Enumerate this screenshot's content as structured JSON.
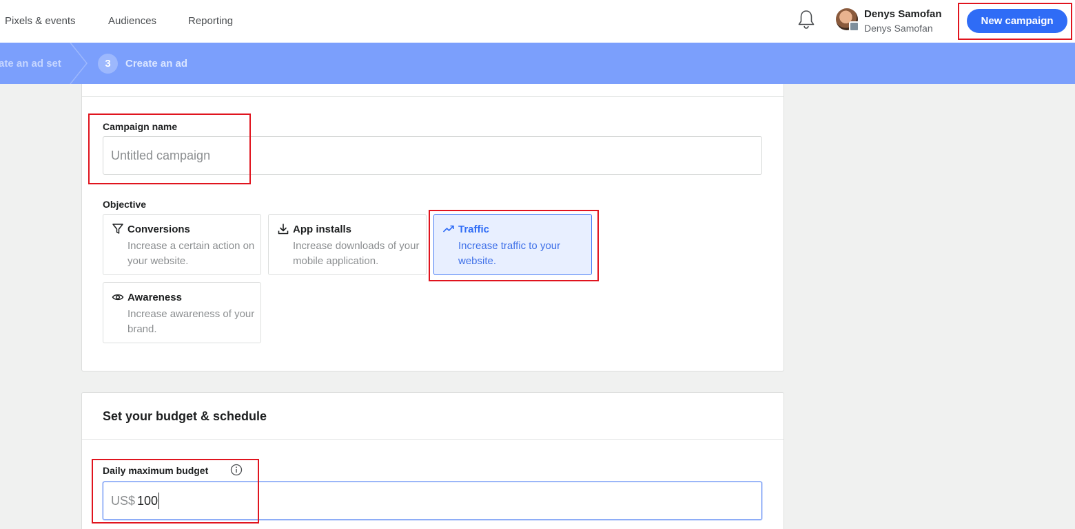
{
  "nav": {
    "items": [
      {
        "label": "Pixels & events"
      },
      {
        "label": "Audiences"
      },
      {
        "label": "Reporting"
      }
    ],
    "user": {
      "name": "Denys Samofan",
      "account": "Denys Samofan"
    },
    "new_campaign_label": "New campaign",
    "icons": {
      "bell": "bell-icon",
      "avatar": "avatar"
    }
  },
  "stepper": {
    "previous_step_label": "ate an ad set",
    "current_step_number": "3",
    "current_step_label": "Create an ad"
  },
  "campaign": {
    "name_label": "Campaign name",
    "name_placeholder": "Untitled campaign",
    "name_value": "",
    "objective_label": "Objective",
    "objectives": [
      {
        "icon": "funnel-icon",
        "title": "Conversions",
        "description": "Increase a certain action on your website.",
        "selected": false
      },
      {
        "icon": "download-icon",
        "title": "App installs",
        "description": "Increase downloads of your mobile application.",
        "selected": false
      },
      {
        "icon": "trending-up-icon",
        "title": "Traffic",
        "description": "Increase traffic to your website.",
        "selected": true
      },
      {
        "icon": "eye-icon",
        "title": "Awareness",
        "description": "Increase awareness of your brand.",
        "selected": false
      }
    ]
  },
  "budget": {
    "section_title": "Set your budget & schedule",
    "daily_label": "Daily maximum budget",
    "currency": "US$",
    "value": "100",
    "info_icon": "info-icon"
  },
  "colors": {
    "accent": "#2f6cf6",
    "stepper_bg": "#7b9ffc",
    "selected_bg": "#e8efff",
    "annotation": "#e0141e"
  }
}
